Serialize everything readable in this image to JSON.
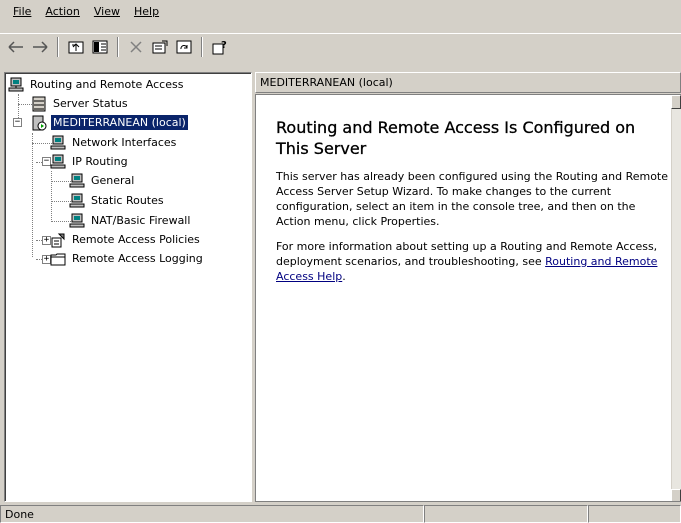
{
  "menu": {
    "items": [
      {
        "label": "File"
      },
      {
        "label": "Action"
      },
      {
        "label": "View"
      },
      {
        "label": "Help"
      }
    ]
  },
  "toolbar": {
    "buttons": [
      "back-icon",
      "forward-icon",
      "up-one-level-icon",
      "show-hide-tree-icon",
      "delete-icon",
      "properties-icon",
      "refresh-icon",
      "help-icon"
    ]
  },
  "tree": {
    "root_label": "Routing and Remote Access",
    "server_status_label": "Server Status",
    "server_label": "MEDITERRANEAN (local)",
    "network_interfaces_label": "Network Interfaces",
    "ip_routing_label": "IP Routing",
    "general_label": "General",
    "static_routes_label": "Static Routes",
    "nat_label": "NAT/Basic Firewall",
    "policies_label": "Remote Access Policies",
    "logging_label": "Remote Access Logging"
  },
  "right_pane": {
    "header": "MEDITERRANEAN (local)",
    "heading": "Routing and Remote Access Is Configured on This Server",
    "paragraph1": "This server has already been configured using the Routing and Remote Access Server Setup Wizard. To make changes to the current configuration, select an item in the console tree, and then on the Action menu, click Properties.",
    "paragraph2_prefix": "For more information about setting up a Routing and Remote Access, deployment scenarios, and troubleshooting, see ",
    "help_link": "Routing and Remote Access Help",
    "paragraph2_suffix": "."
  },
  "status": {
    "text": "Done"
  }
}
